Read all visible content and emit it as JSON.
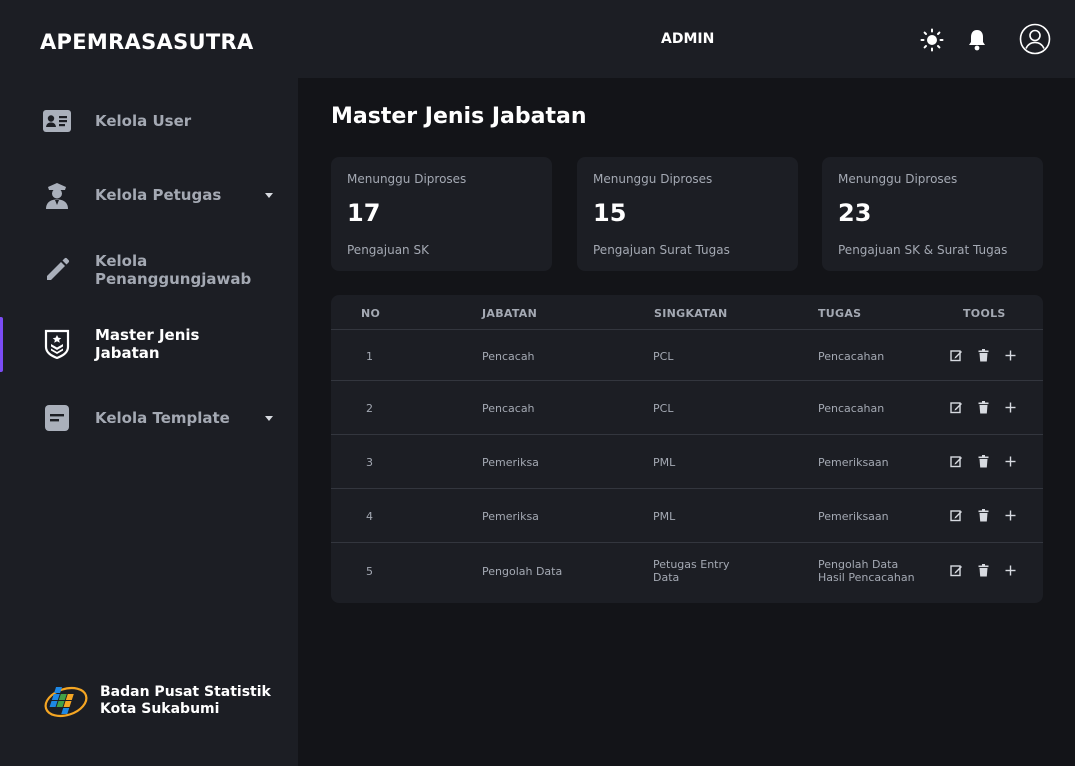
{
  "app": {
    "title": "APEMRASASUTRA",
    "role": "ADMIN"
  },
  "sidebar": {
    "items": [
      {
        "label": "Kelola User",
        "icon": "id-card-icon"
      },
      {
        "label": "Kelola Petugas",
        "icon": "officer-icon",
        "has_dropdown": true
      },
      {
        "label": "Kelola Penanggungjawab",
        "icon": "pencil-icon"
      },
      {
        "label": "Master Jenis Jabatan",
        "icon": "rank-badge-icon",
        "active": true
      },
      {
        "label": "Kelola Template",
        "icon": "document-icon",
        "has_dropdown": true
      }
    ],
    "org": {
      "line1": "Badan Pusat Statistik",
      "line2": "Kota Sukabumi"
    }
  },
  "main": {
    "title": "Master Jenis Jabatan",
    "cards": [
      {
        "label": "Menunggu Diproses",
        "value": "17",
        "sub": "Pengajuan SK"
      },
      {
        "label": "Menunggu Diproses",
        "value": "15",
        "sub": "Pengajuan Surat Tugas"
      },
      {
        "label": "Menunggu Diproses",
        "value": "23",
        "sub": "Pengajuan SK & Surat Tugas"
      }
    ],
    "table": {
      "headers": {
        "no": "NO",
        "jabatan": "JABATAN",
        "singkatan": "SINGKATAN",
        "tugas": "TUGAS",
        "tools": "TOOLS"
      },
      "rows": [
        {
          "no": "1",
          "jabatan": "Pencacah",
          "singkatan": "PCL",
          "tugas": "Pencacahan"
        },
        {
          "no": "2",
          "jabatan": "Pencacah",
          "singkatan": "PCL",
          "tugas": "Pencacahan"
        },
        {
          "no": "3",
          "jabatan": "Pemeriksa",
          "singkatan": "PML",
          "tugas": "Pemeriksaan"
        },
        {
          "no": "4",
          "jabatan": "Pemeriksa",
          "singkatan": "PML",
          "tugas": "Pemeriksaan"
        },
        {
          "no": "5",
          "jabatan": "Pengolah Data",
          "singkatan": "Petugas Entry Data",
          "tugas": "Pengolah Data Hasil Pencacahan"
        }
      ]
    }
  },
  "colors": {
    "accent": "#7b4cf5",
    "panel": "#1c1e24",
    "background": "#131418",
    "muted_text": "#a4a9b3"
  }
}
